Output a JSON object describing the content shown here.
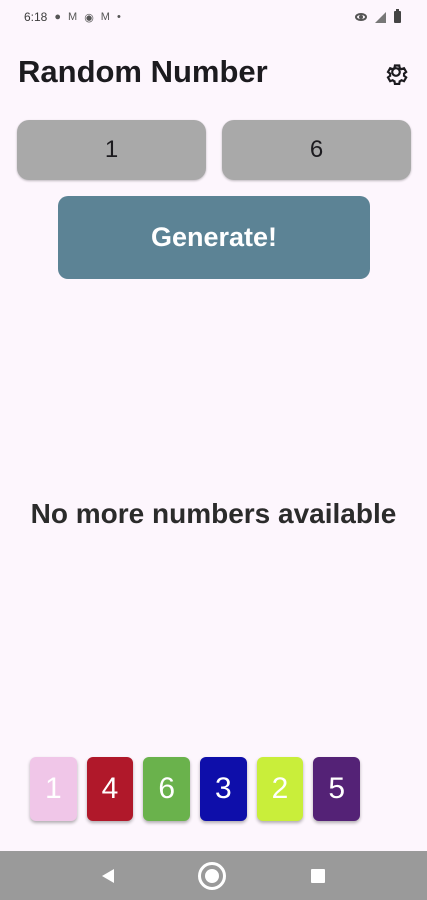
{
  "status_bar": {
    "time": "6:18",
    "icons": [
      "chat-icon",
      "gmail-icon",
      "privacy-icon",
      "gmail-icon",
      "dot-icon"
    ],
    "right_icons": [
      "eye-icon",
      "signal-icon",
      "battery-icon"
    ]
  },
  "header": {
    "title": "Random Number",
    "settings_icon": "gear-icon"
  },
  "range": {
    "min": "1",
    "max": "6"
  },
  "generate_label": "Generate!",
  "message": "No more numbers available",
  "history": [
    {
      "value": "1",
      "color": "#f0c6e8"
    },
    {
      "value": "4",
      "color": "#b0182a"
    },
    {
      "value": "6",
      "color": "#6ab24c"
    },
    {
      "value": "3",
      "color": "#0e0eaa"
    },
    {
      "value": "2",
      "color": "#c9ee3a"
    },
    {
      "value": "5",
      "color": "#542276"
    }
  ],
  "colors": {
    "background": "#fdf6fd",
    "field": "#a9a9a9",
    "button": "#5c8395",
    "nav_bar": "#9a9a9a"
  }
}
